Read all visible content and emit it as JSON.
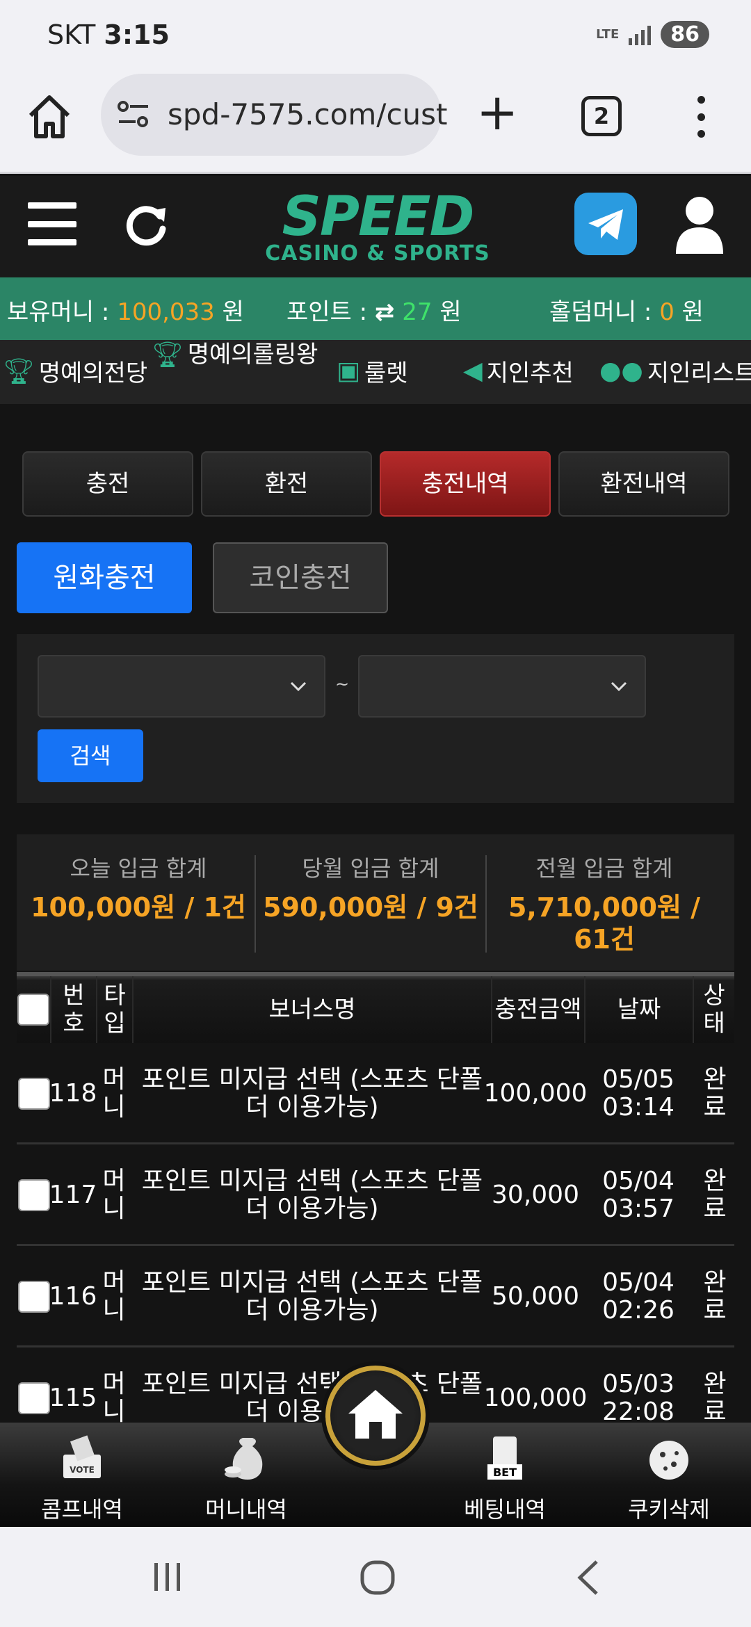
{
  "status_bar": {
    "carrier": "SKT",
    "time": "3:15",
    "network": "LTE",
    "battery": "86"
  },
  "browser": {
    "url": "spd-7575.com/cust",
    "tab_count": "2"
  },
  "logo": {
    "big": "SPEED",
    "small": "CASINO & SPORTS"
  },
  "balance": {
    "money_label": "보유머니 :",
    "money_value": "100,033",
    "money_unit": "원",
    "point_label": "포인트 :",
    "point_value": "27",
    "point_unit": "원",
    "holdem_label": "홀덤머니 :",
    "holdem_value": "0",
    "holdem_unit": "원"
  },
  "menu": {
    "hall_of_fame": "명예의전당",
    "hall_rolling": "명예의롤링왕",
    "roulette": "룰렛",
    "referral": "지인추천",
    "referral_list": "지인리스트"
  },
  "tabs": [
    "충전",
    "환전",
    "충전내역",
    "환전내역"
  ],
  "active_tab": "충전내역",
  "subtabs": {
    "krw": "원화충전",
    "coin": "코인충전"
  },
  "search": {
    "button": "검색",
    "separator": "~"
  },
  "summary": [
    {
      "label": "오늘 입금 합계",
      "value": "100,000원 / 1건"
    },
    {
      "label": "당월 입금 합계",
      "value": "590,000원 / 9건"
    },
    {
      "label": "전월 입금 합계",
      "value": "5,710,000원 / 61건"
    }
  ],
  "table": {
    "headers": {
      "no": "번호",
      "type": "타입",
      "bonus": "보너스명",
      "amount": "충전금액",
      "date": "날짜",
      "status": "상태"
    },
    "rows": [
      {
        "no": "118",
        "type": "머니",
        "bonus": "포인트 미지급 선택 (스포츠 단폴더 이용가능)",
        "amount": "100,000",
        "date": "05/05 03:14",
        "status": "완료"
      },
      {
        "no": "117",
        "type": "머니",
        "bonus": "포인트 미지급 선택 (스포츠 단폴더 이용가능)",
        "amount": "30,000",
        "date": "05/04 03:57",
        "status": "완료"
      },
      {
        "no": "116",
        "type": "머니",
        "bonus": "포인트 미지급 선택 (스포츠 단폴더 이용가능)",
        "amount": "50,000",
        "date": "05/04 02:26",
        "status": "완료"
      },
      {
        "no": "115",
        "type": "머니",
        "bonus": "포인트 미지급 선택 (스포츠 단폴더 이용가능)",
        "amount": "100,000",
        "date": "05/03 22:08",
        "status": "완료"
      }
    ]
  },
  "bottom_nav": {
    "comp": "콤프내역",
    "money": "머니내역",
    "betting": "베팅내역",
    "cookie": "쿠키삭제",
    "bet_badge": "BET",
    "vote_badge": "VOTE"
  },
  "colors": {
    "accent_green": "#2b8566",
    "brand_teal": "#2fb38c",
    "active_red": "#b52a2a",
    "primary_blue": "#1673f5",
    "highlight_orange": "#f6a425"
  }
}
